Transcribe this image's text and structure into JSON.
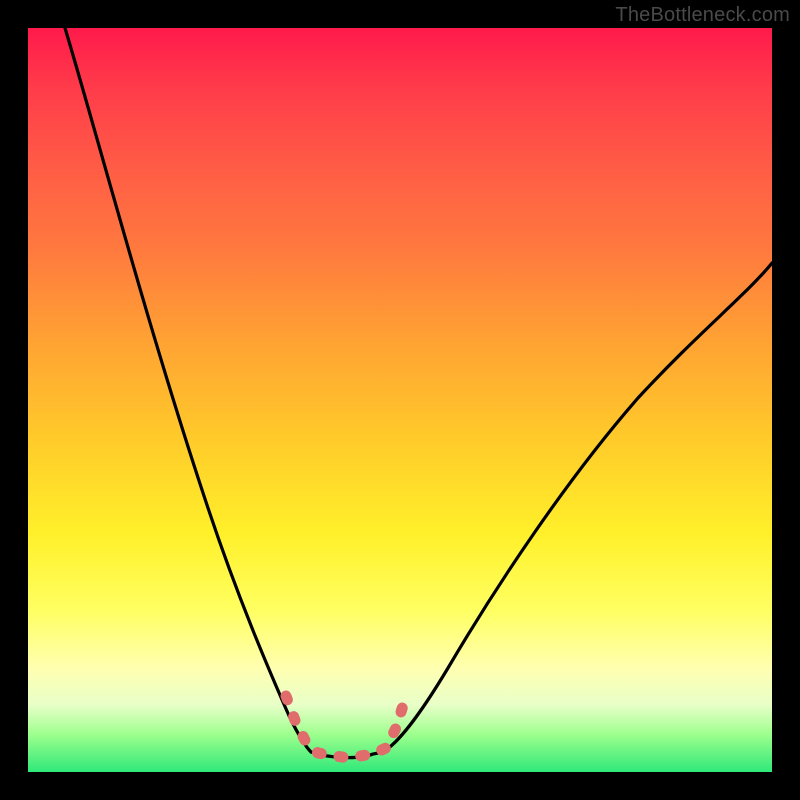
{
  "watermark": {
    "text": "TheBottleneck.com"
  },
  "palette": {
    "curve_stroke": "#000000",
    "dash_stroke": "#e06c6c",
    "background_black": "#000000"
  },
  "chart_data": {
    "type": "line",
    "title": "",
    "xlabel": "",
    "ylabel": "",
    "xlim": [
      0,
      100
    ],
    "ylim": [
      0,
      100
    ],
    "grid": false,
    "legend": false,
    "note": "Values are approximate, read from pixel geometry. y=100 is top (high bottleneck), y=0 is bottom (no bottleneck). x is horizontal position as percent of plot width.",
    "series": [
      {
        "name": "left-branch",
        "x": [
          5,
          8,
          12,
          16,
          20,
          24,
          28,
          31,
          33,
          35,
          36.5,
          37.5
        ],
        "values": [
          100,
          90,
          78,
          66,
          54,
          42,
          30,
          20,
          13,
          8,
          4.5,
          3
        ]
      },
      {
        "name": "flat-minimum",
        "x": [
          37.5,
          40,
          43,
          46,
          47.5
        ],
        "values": [
          3,
          2.5,
          2.3,
          2.5,
          3
        ]
      },
      {
        "name": "right-branch",
        "x": [
          47.5,
          49,
          52,
          56,
          62,
          70,
          80,
          90,
          100
        ],
        "values": [
          3,
          4.5,
          9,
          16,
          26,
          38,
          50,
          60,
          69
        ]
      }
    ],
    "annotations": [
      {
        "name": "dashed-bracket",
        "type": "dashed-polyline",
        "color": "#e06c6c",
        "points_x": [
          34.5,
          36,
          37.5,
          40,
          43,
          46,
          47.5,
          49,
          50.5
        ],
        "points_values": [
          10,
          5.5,
          3,
          2.5,
          2.3,
          2.5,
          3,
          5.5,
          10
        ]
      }
    ]
  }
}
